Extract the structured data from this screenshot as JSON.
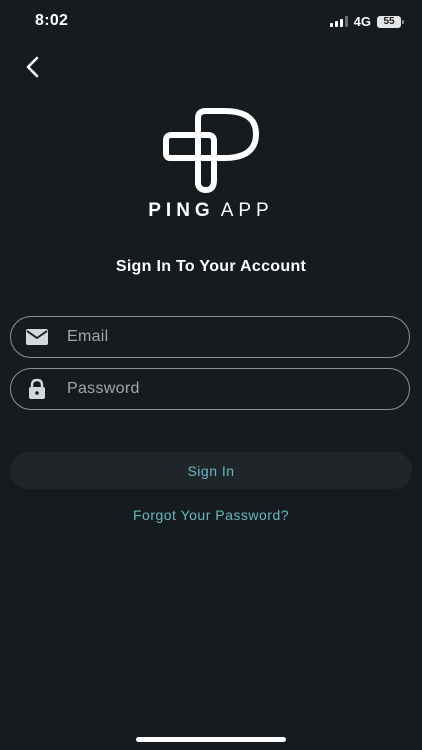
{
  "status_bar": {
    "time": "8:02",
    "network": "4G",
    "battery": "55",
    "signal_icon": "cellular-signal-icon",
    "battery_icon": "battery-icon"
  },
  "nav": {
    "back_icon": "chevron-left-icon"
  },
  "logo": {
    "icon": "ping-logo-mark",
    "name_bold": "PING",
    "name_light": "APP"
  },
  "heading": "Sign In To Your Account",
  "form": {
    "email": {
      "icon": "envelope-icon",
      "placeholder": "Email",
      "value": ""
    },
    "password": {
      "icon": "lock-icon",
      "placeholder": "Password",
      "value": ""
    },
    "submit_label": "Sign In",
    "forgot_label": "Forgot Your Password?"
  },
  "colors": {
    "background": "#151b1e",
    "accent": "#66b9c1",
    "button_bg": "#1f2529",
    "field_border": "#8c9196",
    "text": "#ffffff"
  }
}
